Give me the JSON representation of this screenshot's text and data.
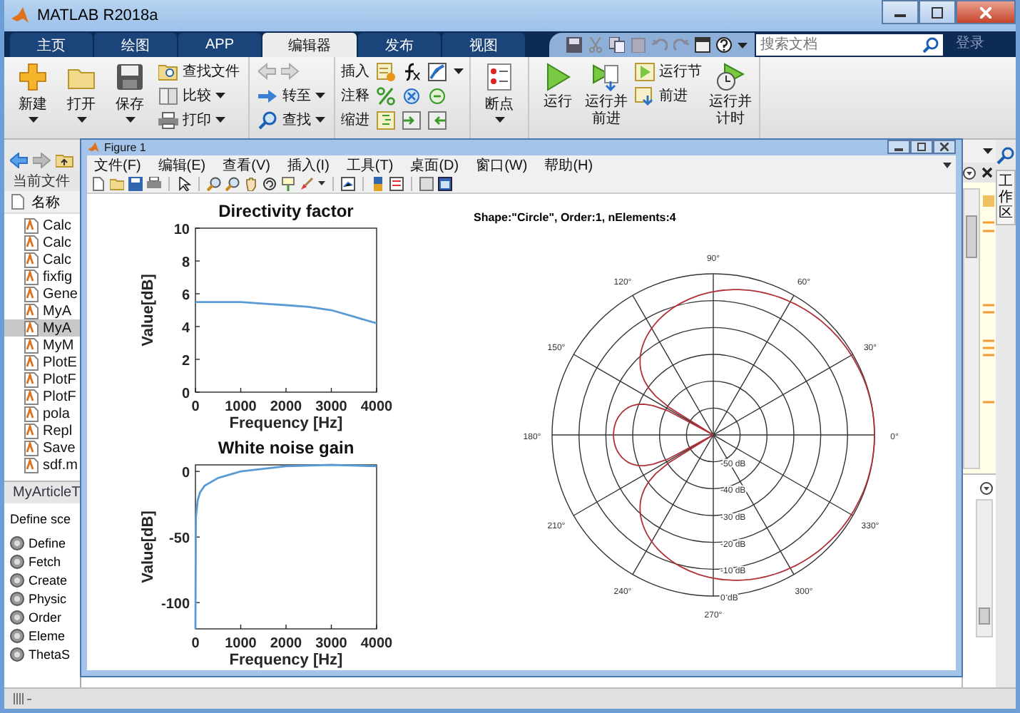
{
  "window": {
    "title": "MATLAB R2018a"
  },
  "tabs": [
    {
      "label": "主页",
      "selected": false
    },
    {
      "label": "绘图",
      "selected": false
    },
    {
      "label": "APP",
      "selected": false
    },
    {
      "label": "编辑器",
      "selected": true
    },
    {
      "label": "发布",
      "selected": false
    },
    {
      "label": "视图",
      "selected": false
    }
  ],
  "search": {
    "placeholder": "搜索文档"
  },
  "login": "登录",
  "ribbon": {
    "big_file": [
      "新建",
      "打开",
      "保存"
    ],
    "small_file": [
      "查找文件",
      "比较",
      "打印"
    ],
    "navigate": [
      "转至",
      "查找"
    ],
    "edit": [
      "插入",
      "注释",
      "缩进"
    ],
    "breakpoints": "断点",
    "run_big": [
      "运行",
      "运行并前进"
    ],
    "run_small": [
      "运行节",
      "前进"
    ],
    "run_timed": "运行并计时"
  },
  "current_folder": {
    "label": "当前文件",
    "column": "名称",
    "files": [
      {
        "name": "Calc",
        "selected": false
      },
      {
        "name": "Calc",
        "selected": false
      },
      {
        "name": "Calc",
        "selected": false
      },
      {
        "name": "fixfig",
        "selected": false
      },
      {
        "name": "Gene",
        "selected": false
      },
      {
        "name": "MyA",
        "selected": false
      },
      {
        "name": "MyA",
        "selected": true
      },
      {
        "name": "MyM",
        "selected": false
      },
      {
        "name": "PlotE",
        "selected": false
      },
      {
        "name": "PlotF",
        "selected": false
      },
      {
        "name": "PlotF",
        "selected": false
      },
      {
        "name": "pola",
        "selected": false
      },
      {
        "name": "Repl",
        "selected": false
      },
      {
        "name": "Save",
        "selected": false
      },
      {
        "name": "sdf.m",
        "selected": false
      }
    ]
  },
  "details": {
    "title": "MyArticleT",
    "description": "Define sce",
    "items": [
      "Define",
      "Fetch",
      "Create",
      "Physic",
      "Order",
      "Eleme",
      "ThetaS"
    ]
  },
  "workspace_tab": "工作区",
  "figure": {
    "title": "Figure 1",
    "menus": [
      "文件(F)",
      "编辑(E)",
      "查看(V)",
      "插入(I)",
      "工具(T)",
      "桌面(D)",
      "窗口(W)",
      "帮助(H)"
    ],
    "charts": [
      {
        "chart_data": {
          "type": "line",
          "title": "Directivity factor",
          "xlabel": "Frequency [Hz]",
          "ylabel": "Value[dB]",
          "x": [
            0,
            500,
            1000,
            1500,
            2000,
            2500,
            3000,
            3500,
            4000
          ],
          "series": [
            {
              "color": "#5b9bd5",
              "values": [
                5.5,
                5.5,
                5.5,
                5.4,
                5.3,
                5.2,
                5.0,
                4.6,
                4.2
              ]
            }
          ],
          "xlim": [
            0,
            4000
          ],
          "ylim": [
            0,
            10
          ],
          "xticks": [
            0,
            1000,
            2000,
            3000,
            4000
          ],
          "yticks": [
            0,
            2,
            4,
            6,
            8,
            10
          ]
        }
      },
      {
        "chart_data": {
          "type": "line",
          "title": "White noise gain",
          "xlabel": "Frequency [Hz]",
          "ylabel": "Value[dB]",
          "x": [
            0,
            10,
            50,
            100,
            200,
            500,
            1000,
            2000,
            3000,
            4000
          ],
          "series": [
            {
              "color": "#5b9bd5",
              "values": [
                -120,
                -35,
                -22,
                -16,
                -11,
                -5,
                0,
                4,
                5,
                4
              ]
            }
          ],
          "xlim": [
            0,
            4000
          ],
          "ylim": [
            -120,
            5
          ],
          "xticks": [
            0,
            1000,
            2000,
            3000,
            4000
          ],
          "yticks": [
            -100,
            -50,
            0
          ]
        }
      }
    ],
    "polar": {
      "title": "Shape:\"Circle\", Order:1, nElements:4",
      "angle_labels": [
        "0°",
        "30°",
        "60°",
        "90°",
        "120°",
        "150°",
        "180°",
        "210°",
        "240°",
        "270°",
        "300°",
        "330°"
      ],
      "radius_labels": [
        "-50 dB",
        "-40 dB",
        "-30 dB",
        "-20 dB",
        "-10 dB",
        "0 dB"
      ]
    }
  }
}
